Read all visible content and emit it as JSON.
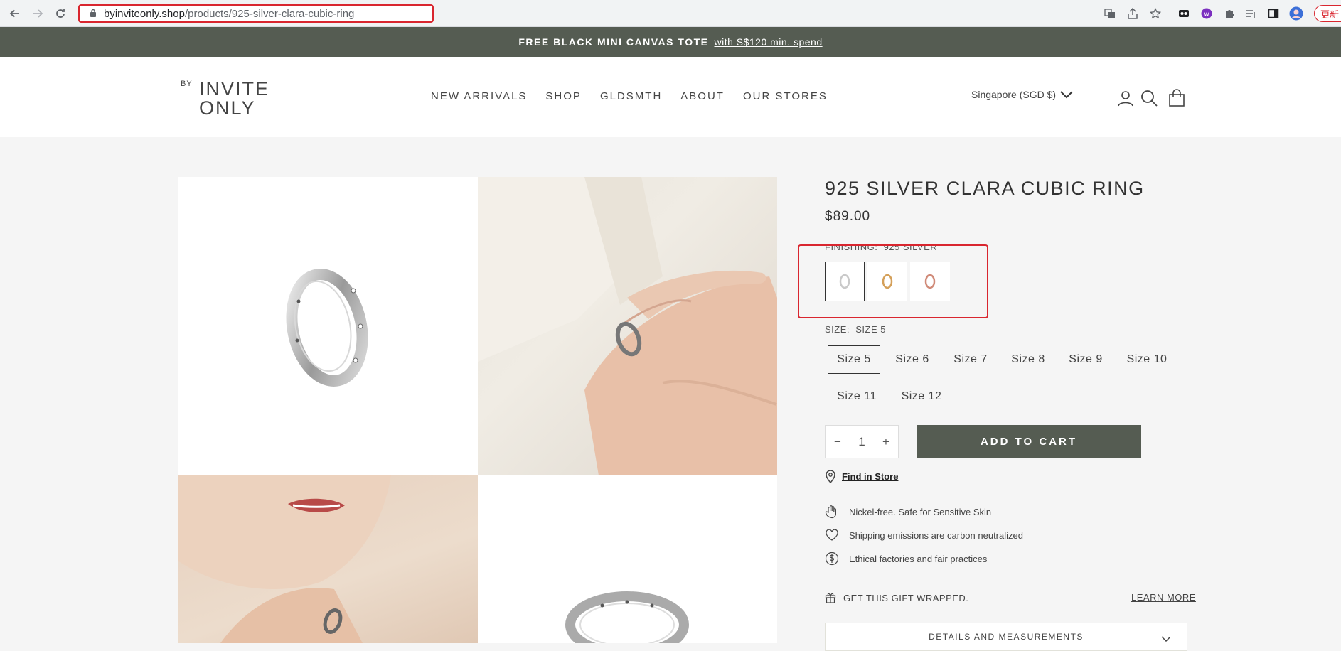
{
  "browser": {
    "url_domain": "byinviteonly.shop",
    "url_path": "/products/925-silver-clara-cubic-ring",
    "update_label": "更新"
  },
  "announcement": {
    "bold": "FREE BLACK MINI CANVAS TOTE",
    "link": "with S$120 min. spend"
  },
  "header": {
    "logo_by": "BY",
    "logo_line1": "INVITE",
    "logo_line2": "ONLY",
    "nav": [
      "NEW ARRIVALS",
      "SHOP",
      "GLDSMTH",
      "ABOUT",
      "OUR STORES"
    ],
    "currency": "Singapore (SGD $)"
  },
  "product": {
    "title": "925 SILVER CLARA CUBIC RING",
    "price": "$89.00",
    "finishing_label": "FINISHING:",
    "finishing_value": "925 SILVER",
    "finishes": [
      "silver",
      "gold",
      "rose-gold"
    ],
    "size_label": "SIZE:",
    "size_value": "SIZE 5",
    "sizes": [
      "Size 5",
      "Size 6",
      "Size 7",
      "Size 8",
      "Size 9",
      "Size 10",
      "Size 11",
      "Size 12"
    ],
    "selected_size": "Size 5",
    "quantity": "1",
    "add_to_cart": "ADD TO CART",
    "find_in_store": "Find in Store",
    "features": [
      "Nickel-free. Safe for Sensitive Skin",
      "Shipping emissions are carbon neutralized",
      "Ethical factories and fair practices"
    ],
    "gift_wrap": "GET THIS GIFT WRAPPED.",
    "learn_more": "LEARN MORE",
    "details_label": "DETAILS AND MEASUREMENTS"
  },
  "colors": {
    "accent": "#555c52",
    "highlight": "#d9262f",
    "silver": "#c9c9c9",
    "gold": "#d4a05a",
    "rose_gold": "#d08a78"
  }
}
